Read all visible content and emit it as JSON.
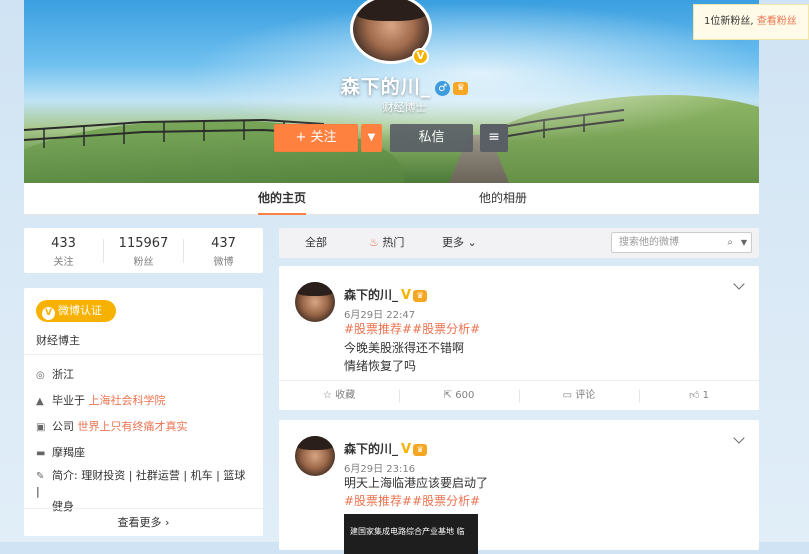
{
  "profile": {
    "name": "森下的川_",
    "subtitle": "财经博士",
    "follow_label": "+ 关注",
    "message_label": "私信"
  },
  "toast": {
    "text": "1位新粉丝, ",
    "link": "查看粉丝"
  },
  "tabs": [
    {
      "label": "他的主页"
    },
    {
      "label": "他的相册"
    }
  ],
  "stats": [
    {
      "value": "433",
      "label": "关注"
    },
    {
      "value": "115967",
      "label": "粉丝"
    },
    {
      "value": "437",
      "label": "微博"
    }
  ],
  "info": {
    "verify_label": "微博认证",
    "role": "财经博主",
    "location": "浙江",
    "school_prefix": "毕业于",
    "school": "上海社会科学院",
    "company_prefix": "公司",
    "company": "世界上只有终痛才真实",
    "zodiac": "摩羯座",
    "bio_prefix": "简介:",
    "bio_line1": "理财投资 | 社群运营 | 机车 | 篮球 |",
    "bio_line2": "健身",
    "more": "查看更多"
  },
  "filter": {
    "all": "全部",
    "hot": "热门",
    "more": "更多",
    "search_placeholder": "搜索他的微博"
  },
  "posts": [
    {
      "name": "森下的川_",
      "time": "6月29日 22:47",
      "tags": "#股票推荐##股票分析#",
      "line1": "今晚美股涨得还不错啊",
      "line2": "情绪恢复了吗",
      "collect": "收藏",
      "repost": "600",
      "comment": "评论",
      "like": "1"
    },
    {
      "name": "森下的川_",
      "time": "6月29日 23:16",
      "line1": "明天上海临港应该要启动了",
      "tags": "#股票推荐##股票分析#",
      "image_text": "建国家集成电路综合产业基地 临"
    }
  ],
  "colors": {
    "accent": "#ff8140",
    "link": "#eb7350",
    "verify": "#f7b100"
  }
}
